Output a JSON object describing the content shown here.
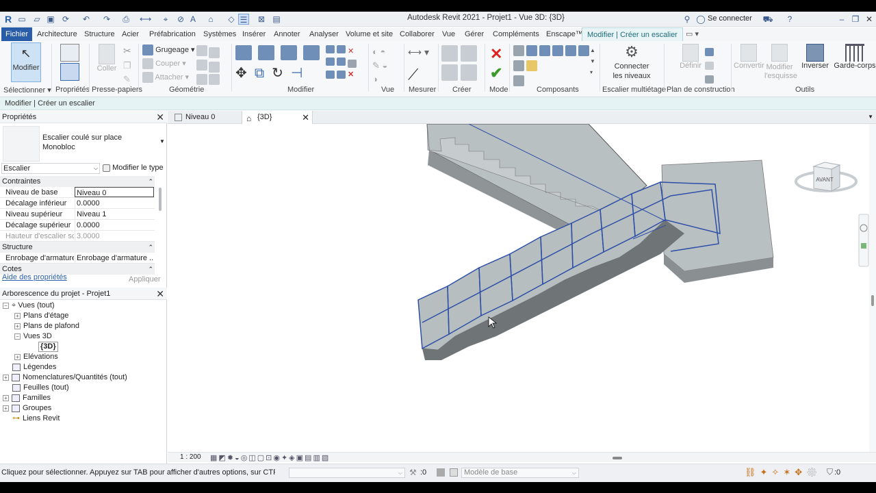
{
  "window": {
    "title": "Autodesk Revit 2021 - Projet1 - Vue 3D: {3D}",
    "signin": "Se connecter"
  },
  "tabs": [
    "Fichier",
    "Architecture",
    "Structure",
    "Acier",
    "Préfabrication",
    "Systèmes",
    "Insérer",
    "Annoter",
    "Analyser",
    "Volume et site",
    "Collaborer",
    "Vue",
    "Gérer",
    "Compléments",
    "Enscape™",
    "Modifier | Créer un escalier"
  ],
  "ribbon": {
    "modifier_btn": "Modifier",
    "grugeage": "Grugeage",
    "couper": "Couper",
    "attacher": "Attacher",
    "coller": "Coller",
    "connecter": "Connecter les niveaux",
    "definir": "Définir",
    "convertir": "Convertir",
    "modifier_esquisse": "Modifier l'esquisse",
    "inverser": "Inverser",
    "garde_corps": "Garde-corps",
    "groups": {
      "selectionner": "Sélectionner",
      "proprietes": "Propriétés",
      "presse_papiers": "Presse-papiers",
      "geometrie": "Géométrie",
      "modifier": "Modifier",
      "vue": "Vue",
      "mesurer": "Mesurer",
      "creer": "Créer",
      "mode": "Mode",
      "composants": "Composants",
      "escalier_multietage": "Escalier multiétage",
      "plan_construction": "Plan de construction",
      "outils": "Outils"
    }
  },
  "context_bar": "Modifier | Créer un escalier",
  "properties": {
    "title": "Propriétés",
    "type_name": "Escalier coulé sur place",
    "type_sub": "Monobloc",
    "selector": "Escalier",
    "edit_type": "Modifier le type",
    "sections": {
      "contraintes": "Contraintes",
      "structure": "Structure",
      "cotes": "Cotes"
    },
    "rows": [
      {
        "k": "Niveau de base",
        "v": "Niveau 0"
      },
      {
        "k": "Décalage inférieur",
        "v": "0.0000"
      },
      {
        "k": "Niveau supérieur",
        "v": "Niveau 1"
      },
      {
        "k": "Décalage supérieur",
        "v": "0.0000"
      },
      {
        "k": "Hauteur d'escalier so...",
        "v": "3.0000"
      }
    ],
    "structure_row": {
      "k": "Enrobage d'armature",
      "v": "Enrobage d'armature ..."
    },
    "help": "Aide des propriétés",
    "apply": "Appliquer"
  },
  "browser": {
    "title": "Arborescence du projet - Projet1",
    "items": [
      "Vues (tout)",
      "Plans d'étage",
      "Plans de plafond",
      "Vues 3D",
      "{3D}",
      "Elévations",
      "Légendes",
      "Nomenclatures/Quantités (tout)",
      "Feuilles (tout)",
      "Familles",
      "Groupes",
      "Liens Revit"
    ]
  },
  "view_tabs": [
    "Niveau 0",
    "{3D}"
  ],
  "viewcube": "AVANT",
  "scale": "1 : 200",
  "status": {
    "hint": "Cliquez pour sélectionner. Appuyez sur TAB pour afficher d'autres options, sur CTRL pour a",
    "count": ":0",
    "model": "Modèle de base",
    "filter": ":0"
  },
  "colors": {
    "accent": "#2a5da8",
    "context": "#e6f3f5",
    "stair_fill": "#b8bfc1",
    "stair_edge": "#2d4fa8"
  }
}
